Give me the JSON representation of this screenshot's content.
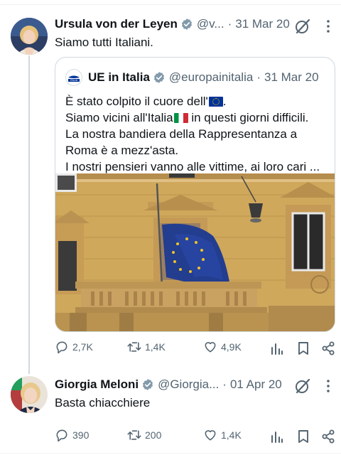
{
  "tweets": [
    {
      "author_name": "Ursula von der Leyen",
      "handle": "@v...",
      "separator_dot": "·",
      "date": "31 Mar 20",
      "text": "Siamo tutti Italiani.",
      "quote": {
        "author_name": "UE in Italia",
        "avatar_label": "ITALIA",
        "handle": "@europainitalia",
        "separator_dot": "·",
        "date": "31 Mar 20",
        "lines": [
          "È stato colpito il cuore dell'",
          "Siamo vicini all'Italia",
          " in questi giorni difficili.",
          "La nostra bandiera della Rappresentanza a",
          "Roma è a mezz'asta.",
          "I nostri pensieri vanno alle vittime, ai loro cari ..."
        ],
        "line1_suffix": "."
      },
      "stats": {
        "replies": "2,7K",
        "retweets": "1,4K",
        "likes": "4,9K"
      }
    },
    {
      "author_name": "Giorgia Meloni",
      "handle": "@Giorgia...",
      "separator_dot": "·",
      "date": "01 Apr 20",
      "text": "Basta chiacchiere",
      "stats": {
        "replies": "390",
        "retweets": "200",
        "likes": "1,4K"
      }
    }
  ],
  "icons": {
    "verified": "verified-badge-icon",
    "grok": "grok-icon",
    "more": "more-icon",
    "reply": "reply-icon",
    "retweet": "retweet-icon",
    "like": "heart-icon",
    "views": "views-icon",
    "bookmark": "bookmark-icon",
    "share": "share-icon"
  },
  "colors": {
    "text_primary": "#0f1419",
    "text_secondary": "#536471",
    "verified": "#829aab",
    "border": "#cfd9de"
  }
}
